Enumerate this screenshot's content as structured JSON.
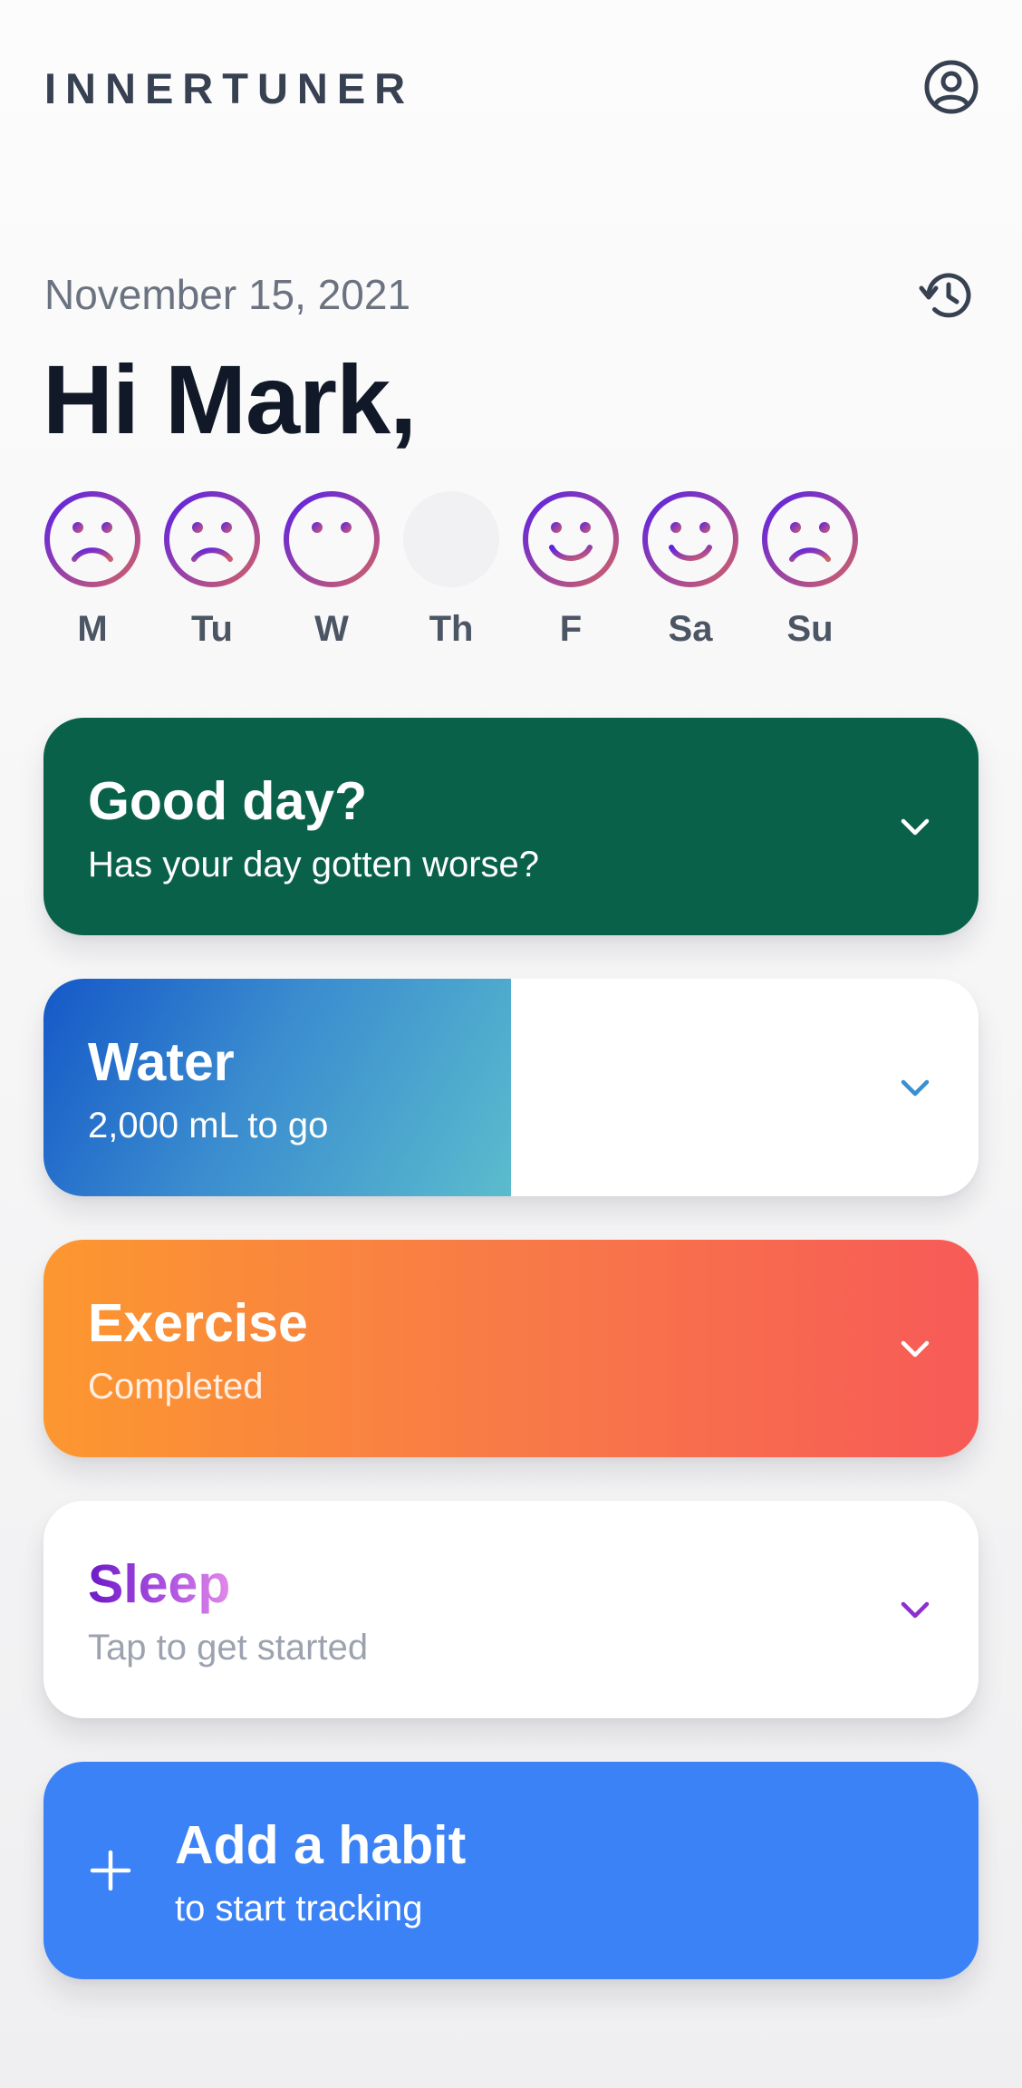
{
  "app": {
    "brand": "INNERTUNER",
    "profile_icon": "user-circle-icon",
    "history_icon": "history-clock-icon"
  },
  "header": {
    "date": "November 15, 2021",
    "greeting": "Hi Mark,"
  },
  "week": [
    {
      "label": "M",
      "mood": "sad"
    },
    {
      "label": "Tu",
      "mood": "sad"
    },
    {
      "label": "W",
      "mood": "neutral"
    },
    {
      "label": "Th",
      "mood": "none"
    },
    {
      "label": "F",
      "mood": "happy"
    },
    {
      "label": "Sa",
      "mood": "happy"
    },
    {
      "label": "Su",
      "mood": "sad"
    }
  ],
  "cards": {
    "mood": {
      "title": "Good day?",
      "subtitle": "Has your day gotten worse?",
      "color": "#0a614a"
    },
    "water": {
      "title": "Water",
      "subtitle": "2,000 mL to go",
      "progress": 0.5
    },
    "exercise": {
      "title": "Exercise",
      "subtitle": "Completed"
    },
    "sleep": {
      "title": "Sleep",
      "subtitle": "Tap to get started"
    },
    "add_habit": {
      "title": "Add a habit",
      "subtitle": "to start tracking",
      "color": "#3b82f6"
    }
  },
  "colors": {
    "mood_gradient_start": "#5b21e6",
    "mood_gradient_end": "#d0606a",
    "water_chevron": "#3b8fd0",
    "sleep_chevron": "#8b2fd0"
  }
}
